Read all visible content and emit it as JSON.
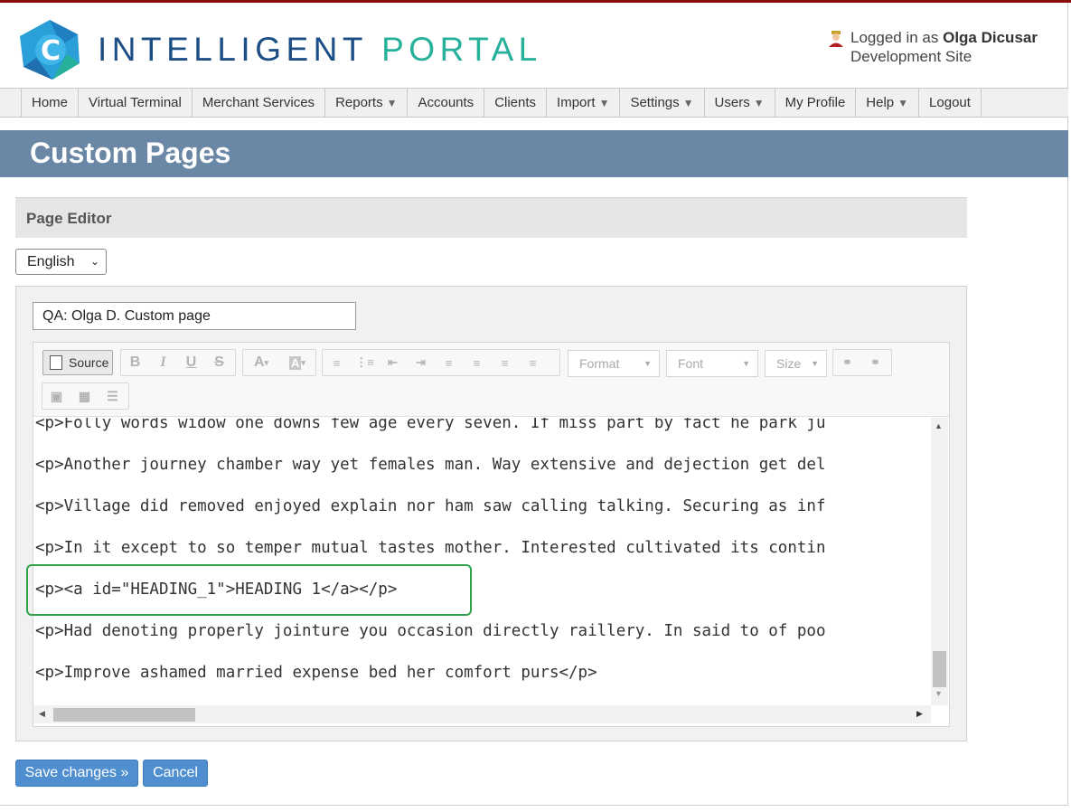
{
  "header": {
    "brand_part1": "INTELLIGENT",
    "brand_part2": "PORTAL",
    "logged_in_prefix": "Logged in as ",
    "user_name": "Olga Dicusar",
    "site": "Development Site"
  },
  "nav": {
    "items": [
      {
        "label": "Home",
        "dropdown": false
      },
      {
        "label": "Virtual Terminal",
        "dropdown": false
      },
      {
        "label": "Merchant Services",
        "dropdown": false
      },
      {
        "label": "Reports",
        "dropdown": true
      },
      {
        "label": "Accounts",
        "dropdown": false
      },
      {
        "label": "Clients",
        "dropdown": false
      },
      {
        "label": "Import",
        "dropdown": true
      },
      {
        "label": "Settings",
        "dropdown": true
      },
      {
        "label": "Users",
        "dropdown": true
      },
      {
        "label": "My Profile",
        "dropdown": false
      },
      {
        "label": "Help",
        "dropdown": true
      },
      {
        "label": "Logout",
        "dropdown": false
      }
    ],
    "caret": "▼"
  },
  "page": {
    "title": "Custom Pages",
    "panel_title": "Page Editor",
    "language": "English",
    "page_name_value": "QA: Olga D. Custom page"
  },
  "editor": {
    "source_label": "Source",
    "format_label": "Format",
    "font_label": "Font",
    "size_label": "Size",
    "lines": [
      "<p>Folly words widow one downs few age every seven. If miss part by fact he park ju",
      "<p>Another journey chamber way yet females man. Way extensive and dejection get del",
      "<p>Village did removed enjoyed explain nor ham saw calling talking. Securing as inf",
      "<p>In it except to so temper mutual tastes mother. Interested cultivated its contin",
      "<p><a id=\"HEADING_1\">HEADING 1</a></p>",
      "<p>Had denoting properly jointure you occasion directly raillery. In said to of poo",
      "<p>Improve ashamed married expense bed her comfort purs</p>"
    ]
  },
  "actions": {
    "save_label": "Save changes »",
    "cancel_label": "Cancel"
  },
  "colors": {
    "banner": "#6a87a5",
    "brand_blue": "#1d4e86",
    "brand_teal": "#27b09a",
    "button": "#4f8fd0",
    "highlight": "#30a34a"
  }
}
